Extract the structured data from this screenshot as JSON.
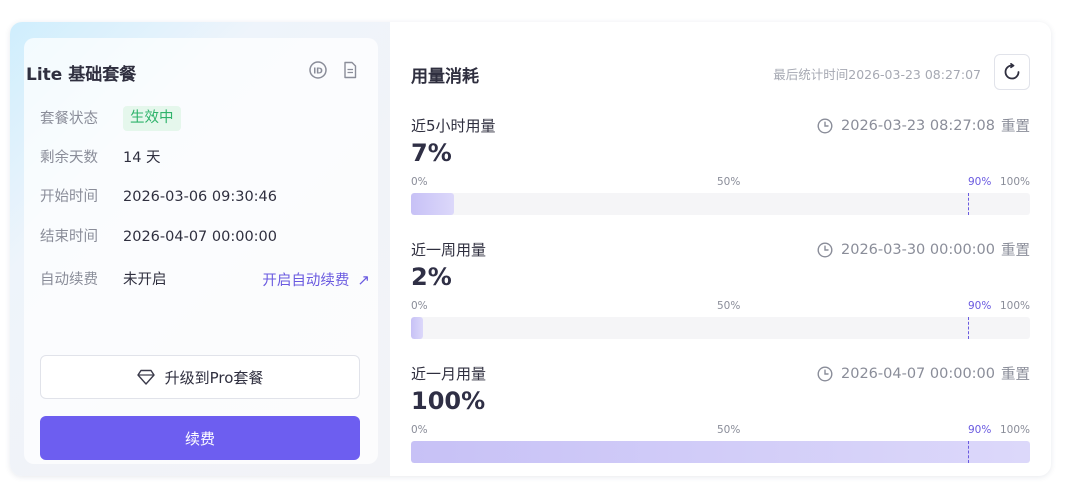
{
  "plan": {
    "title": "Lite 基础套餐",
    "rows": [
      {
        "label": "套餐状态",
        "value": "生效中"
      },
      {
        "label": "剩余天数",
        "value": "14 天"
      },
      {
        "label": "开始时间",
        "value": "2026-03-06 09:30:46"
      },
      {
        "label": "结束时间",
        "value": "2026-04-07 00:00:00"
      },
      {
        "label": "自动续费",
        "value": "未开启"
      }
    ],
    "auto_renew_link": "开启自动续费",
    "upgrade_label": "升级到Pro套餐",
    "renew_label": "续费"
  },
  "usage": {
    "title": "用量消耗",
    "last_stat": "最后统计时间2026-03-23 08:27:07",
    "ticks": {
      "t0": "0%",
      "t50": "50%",
      "t90": "90%",
      "t100": "100%"
    },
    "sections": [
      {
        "name": "近5小时用量",
        "reset_time": "2026-03-23 08:27:08",
        "reset_label": "重置",
        "percent_text": "7%",
        "percent": 7
      },
      {
        "name": "近一周用量",
        "reset_time": "2026-03-30 00:00:00",
        "reset_label": "重置",
        "percent_text": "2%",
        "percent": 2
      },
      {
        "name": "近一月用量",
        "reset_time": "2026-04-07 00:00:00",
        "reset_label": "重置",
        "percent_text": "100%",
        "percent": 100
      }
    ]
  },
  "colors": {
    "accent": "#6d5ef0",
    "badge_bg": "#e5f7ec",
    "badge_text": "#2fb36b"
  },
  "icons": [
    "id-icon",
    "document-icon",
    "diamond-icon",
    "arrow-up-right-icon",
    "refresh-icon",
    "clock-icon"
  ]
}
